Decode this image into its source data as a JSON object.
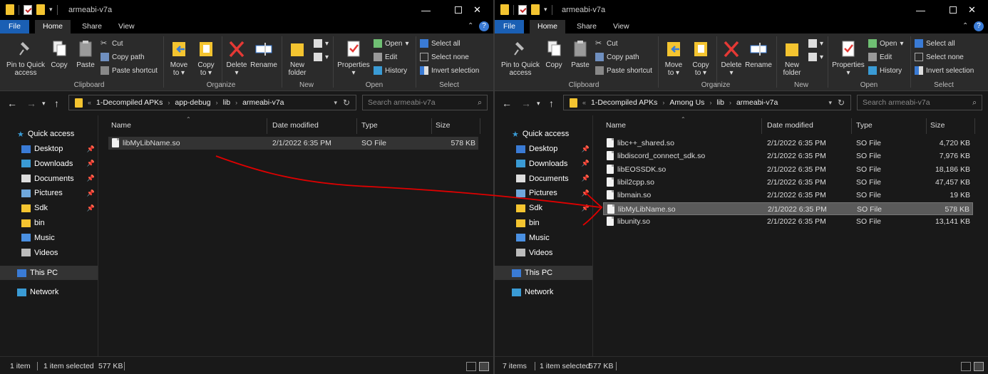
{
  "left_window": {
    "title": "armeabi-v7a",
    "tabs": [
      "File",
      "Home",
      "Share",
      "View"
    ],
    "breadcrumb": [
      "1-Decompiled APKs",
      "app-debug",
      "lib",
      "armeabi-v7a"
    ],
    "search_placeholder": "Search armeabi-v7a",
    "files": [
      {
        "name": "libMyLibName.so",
        "date": "2/1/2022 6:35 PM",
        "type": "SO File",
        "size": "578 KB"
      }
    ],
    "status": {
      "count": "1 item",
      "selected": "1 item selected",
      "size": "577 KB"
    }
  },
  "right_window": {
    "title": "armeabi-v7a",
    "tabs": [
      "File",
      "Home",
      "Share",
      "View"
    ],
    "breadcrumb": [
      "1-Decompiled APKs",
      "Among Us",
      "lib",
      "armeabi-v7a"
    ],
    "search_placeholder": "Search armeabi-v7a",
    "files": [
      {
        "name": "libc++_shared.so",
        "date": "2/1/2022 6:35 PM",
        "type": "SO File",
        "size": "4,720 KB"
      },
      {
        "name": "libdiscord_connect_sdk.so",
        "date": "2/1/2022 6:35 PM",
        "type": "SO File",
        "size": "7,976 KB"
      },
      {
        "name": "libEOSSDK.so",
        "date": "2/1/2022 6:35 PM",
        "type": "SO File",
        "size": "18,186 KB"
      },
      {
        "name": "libil2cpp.so",
        "date": "2/1/2022 6:35 PM",
        "type": "SO File",
        "size": "47,457 KB"
      },
      {
        "name": "libmain.so",
        "date": "2/1/2022 6:35 PM",
        "type": "SO File",
        "size": "19 KB"
      },
      {
        "name": "libMyLibName.so",
        "date": "2/1/2022 6:35 PM",
        "type": "SO File",
        "size": "578 KB"
      },
      {
        "name": "libunity.so",
        "date": "2/1/2022 6:35 PM",
        "type": "SO File",
        "size": "13,141 KB"
      }
    ],
    "selected_row": 5,
    "status": {
      "count": "7 items",
      "selected": "1 item selected",
      "size": "577 KB"
    }
  },
  "ribbon": {
    "pin_label1": "Pin to Quick",
    "pin_label2": "access",
    "copy": "Copy",
    "paste": "Paste",
    "cut": "Cut",
    "copy_path": "Copy path",
    "paste_shortcut": "Paste shortcut",
    "move_to1": "Move",
    "move_to2": "to",
    "copy_to1": "Copy",
    "copy_to2": "to",
    "delete": "Delete",
    "rename": "Rename",
    "new_folder1": "New",
    "new_folder2": "folder",
    "properties": "Properties",
    "open": "Open",
    "edit": "Edit",
    "history": "History",
    "select_all": "Select all",
    "select_none": "Select none",
    "invert_selection": "Invert selection",
    "groups": {
      "clipboard": "Clipboard",
      "organize": "Organize",
      "new": "New",
      "open": "Open",
      "select": "Select"
    }
  },
  "columns": {
    "name": "Name",
    "date": "Date modified",
    "type": "Type",
    "size": "Size"
  },
  "nav": {
    "quick_access": "Quick access",
    "items": [
      "Desktop",
      "Downloads",
      "Documents",
      "Pictures",
      "Sdk",
      "bin",
      "Music",
      "Videos"
    ],
    "this_pc": "This PC",
    "network": "Network"
  },
  "annotation": {
    "arrow_color": "#e00000"
  },
  "colors": {
    "accent": "#1a5fb4",
    "folder": "#f4c430",
    "background": "#191919"
  }
}
